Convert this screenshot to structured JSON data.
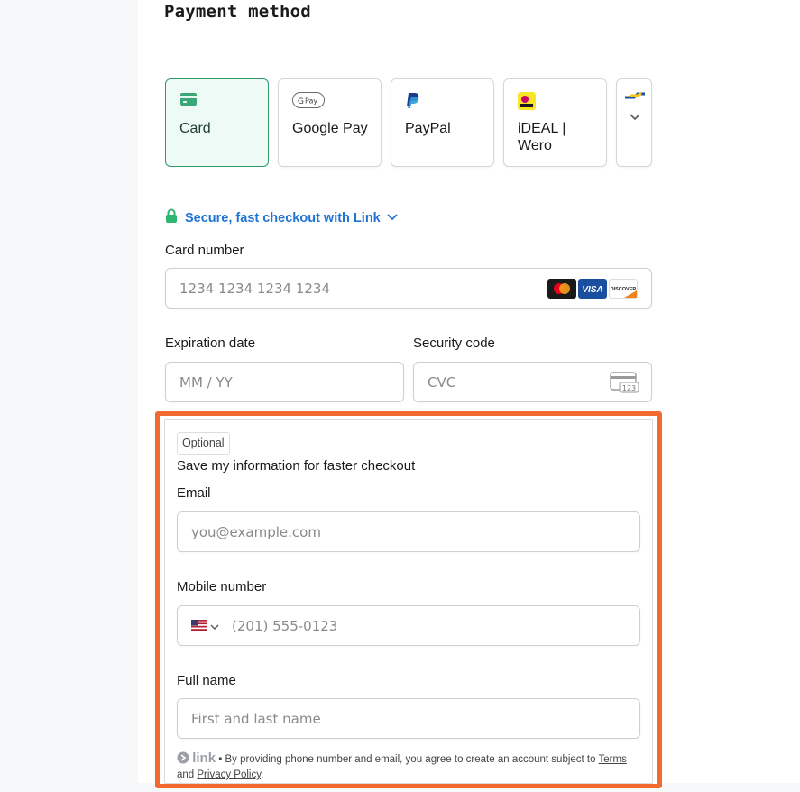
{
  "header": {
    "title": "Payment method"
  },
  "tabs": [
    {
      "label": "Card",
      "selected": true
    },
    {
      "label": "Google Pay",
      "selected": false
    },
    {
      "label": "PayPal",
      "selected": false
    },
    {
      "label": "iDEAL | Wero",
      "selected": false
    }
  ],
  "link": {
    "text": "Secure, fast checkout with Link"
  },
  "card_number": {
    "label": "Card number",
    "placeholder": "1234 1234 1234 1234"
  },
  "expiry": {
    "label": "Expiration date",
    "placeholder": "MM / YY"
  },
  "cvc": {
    "label": "Security code",
    "placeholder": "CVC",
    "icon_text": "123"
  },
  "save_section": {
    "badge": "Optional",
    "title": "Save my information for faster checkout",
    "email": {
      "label": "Email",
      "placeholder": "you@example.com"
    },
    "mobile": {
      "label": "Mobile number",
      "placeholder": "(201) 555-0123"
    },
    "full_name": {
      "label": "Full name",
      "placeholder": "First and last name"
    },
    "footer": {
      "logo": "link",
      "text": " • By providing phone number and email, you agree to create an account subject to ",
      "terms": "Terms",
      "and": " and ",
      "privacy": "Privacy Policy",
      "end": "."
    }
  },
  "colors": {
    "accent_green": "#2f9a6a",
    "link_blue": "#1f74d6",
    "highlight_orange": "#f26a2f"
  },
  "icons": [
    "card-icon",
    "google-pay-icon",
    "paypal-icon",
    "ideal-wero-icon",
    "lock-icon",
    "chevron-down-icon",
    "mastercard-icon",
    "visa-icon",
    "discover-icon",
    "cvc-card-icon",
    "us-flag-icon"
  ]
}
